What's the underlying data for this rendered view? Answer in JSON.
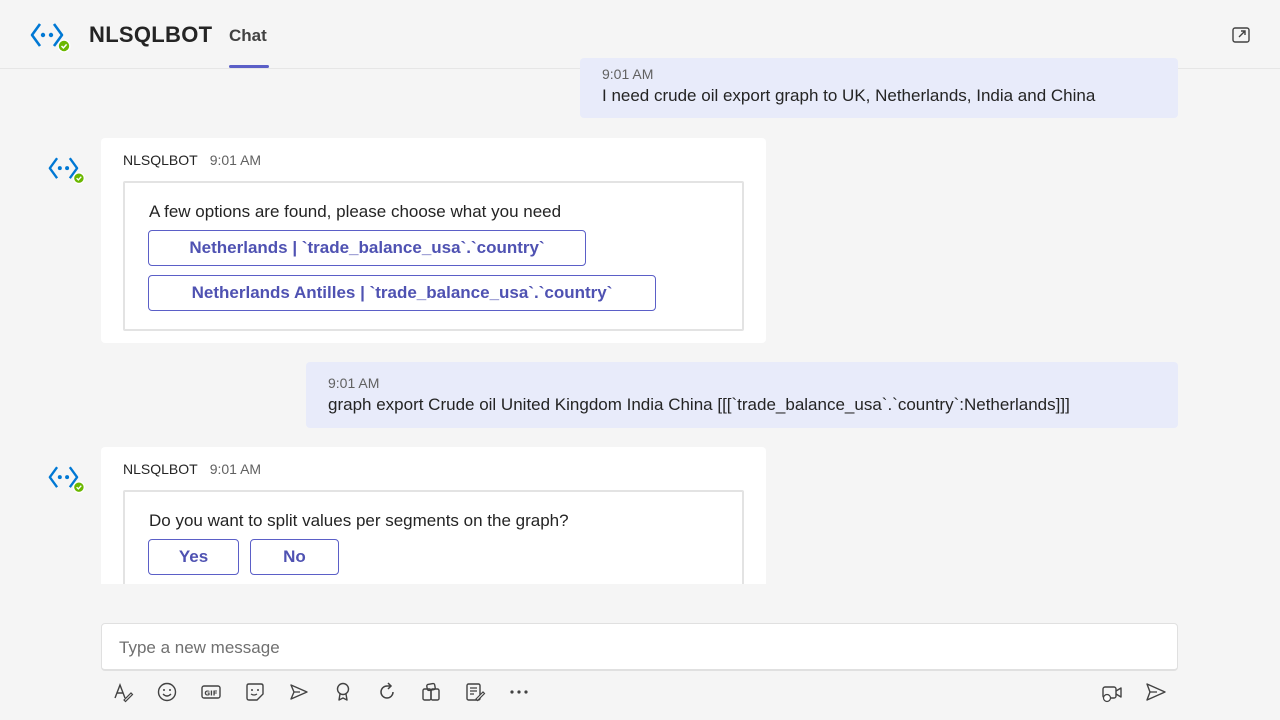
{
  "header": {
    "app_name": "NLSQLBOT",
    "tab_chat": "Chat"
  },
  "messages": {
    "user1": {
      "time": "9:01 AM",
      "text": "I need crude oil export graph to UK, Netherlands, India and China"
    },
    "bot1": {
      "name": "NLSQLBOT",
      "time": "9:01 AM",
      "prompt": "A few options are found, please choose what you need",
      "options": [
        "Netherlands | `trade_balance_usa`.`country`",
        "Netherlands Antilles | `trade_balance_usa`.`country`"
      ]
    },
    "user2": {
      "time": "9:01 AM",
      "text": "graph export Crude oil United Kingdom India China [[[`trade_balance_usa`.`country`:Netherlands]]]"
    },
    "bot2": {
      "name": "NLSQLBOT",
      "time": "9:01 AM",
      "prompt": "Do you want to split values per segments on the graph?",
      "yes_label": "Yes",
      "no_label": "No"
    }
  },
  "compose": {
    "placeholder": "Type a new message"
  },
  "toolbar": {
    "icons": [
      "format-icon",
      "emoji-icon",
      "gif-icon",
      "sticker-icon",
      "meet-now-icon",
      "praise-icon",
      "loop-icon",
      "apps-icon",
      "forms-icon",
      "more-options-icon",
      "video-clip-icon",
      "send-icon"
    ]
  },
  "colors": {
    "accent": "#5b5fc7",
    "user_bubble": "#e8ebfa",
    "background": "#f5f5f5",
    "bot_logo": "#0078d4",
    "status_green": "#6bb700"
  }
}
